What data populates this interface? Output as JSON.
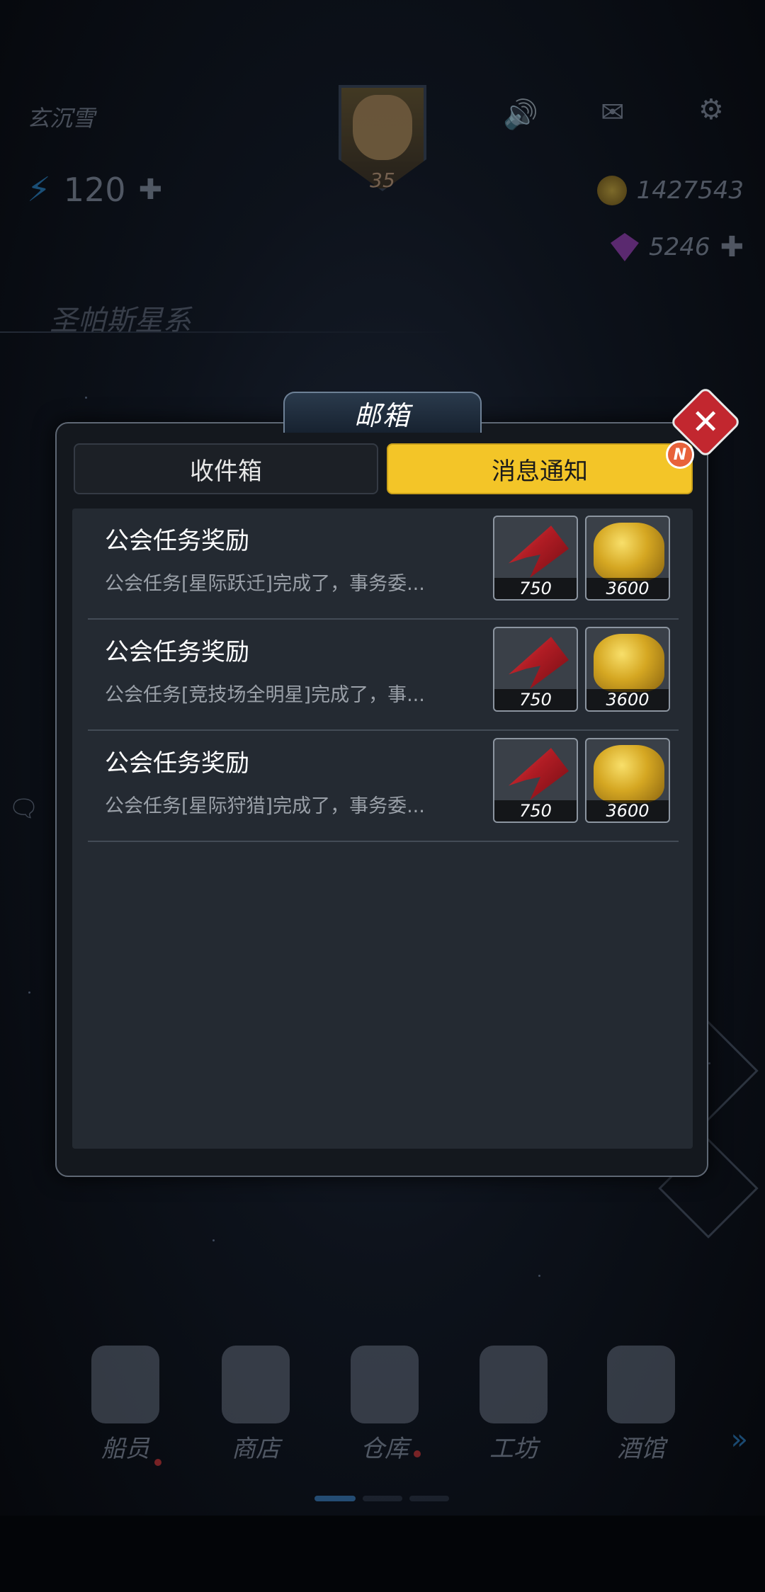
{
  "background": {
    "player_name": "玄沉雪",
    "avatar_level": "35",
    "energy": "120",
    "gold": "1427543",
    "gems": "5246",
    "region": "圣帕斯星系",
    "icons": [
      "announcement-icon",
      "mail-icon",
      "settings-icon",
      "lightning-icon",
      "chat-icon"
    ],
    "nav": [
      {
        "label": "船员",
        "icon": "crew-icon",
        "dot": true
      },
      {
        "label": "商店",
        "icon": "shop-icon",
        "dot": false
      },
      {
        "label": "仓库",
        "icon": "warehouse-icon",
        "dot": true
      },
      {
        "label": "工坊",
        "icon": "workshop-icon",
        "dot": false
      },
      {
        "label": "酒馆",
        "icon": "tavern-icon",
        "dot": false
      }
    ]
  },
  "modal": {
    "title": "邮箱",
    "close_icon": "close-icon",
    "tabs": [
      {
        "label": "收件箱",
        "active": false
      },
      {
        "label": "消息通知",
        "active": true,
        "badge": "N"
      }
    ],
    "accent": "#f3c528",
    "mails": [
      {
        "title": "公会任务奖励",
        "preview": "公会任务[星际跃迁]完成了，事务委...",
        "rewards": [
          {
            "icon": "ruby-icon",
            "qty": "750"
          },
          {
            "icon": "gold-coins-icon",
            "qty": "3600"
          }
        ]
      },
      {
        "title": "公会任务奖励",
        "preview": "公会任务[竞技场全明星]完成了，事...",
        "rewards": [
          {
            "icon": "ruby-icon",
            "qty": "750"
          },
          {
            "icon": "gold-coins-icon",
            "qty": "3600"
          }
        ]
      },
      {
        "title": "公会任务奖励",
        "preview": "公会任务[星际狩猎]完成了，事务委...",
        "rewards": [
          {
            "icon": "ruby-icon",
            "qty": "750"
          },
          {
            "icon": "gold-coins-icon",
            "qty": "3600"
          }
        ]
      }
    ]
  }
}
